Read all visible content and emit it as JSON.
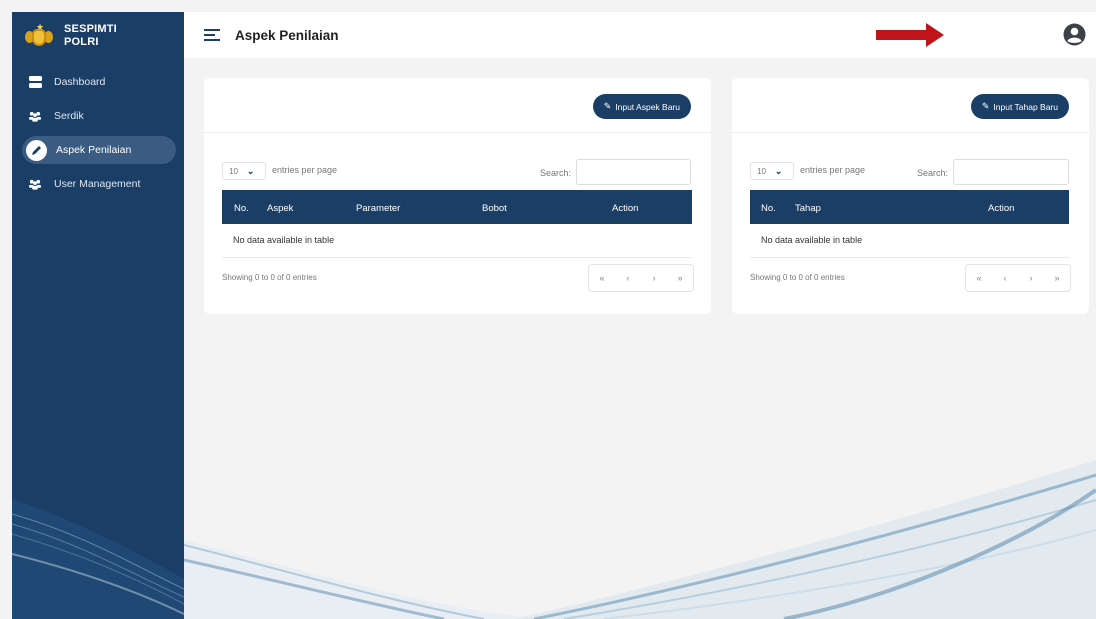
{
  "brand": {
    "line1": "SESPIMTI",
    "line2": "POLRI"
  },
  "sidebar": {
    "items": [
      {
        "label": "Dashboard",
        "icon": "server-icon",
        "active": false
      },
      {
        "label": "Serdik",
        "icon": "users-icon",
        "active": false
      },
      {
        "label": "Aspek Penilaian",
        "icon": "pen-icon",
        "active": true
      },
      {
        "label": "User Management",
        "icon": "users-icon",
        "active": false
      }
    ]
  },
  "header": {
    "title": "Aspek Penilaian"
  },
  "aspek_table": {
    "button_label": "Input Aspek Baru",
    "length_value": "10",
    "length_label": "entries per page",
    "search_label": "Search:",
    "search_value": "",
    "columns": [
      "No.",
      "Aspek",
      "Parameter",
      "Bobot",
      "Action"
    ],
    "empty_message": "No data available in table",
    "info": "Showing 0 to 0 of 0 entries",
    "pager": [
      "«",
      "‹",
      "›",
      "»"
    ]
  },
  "tahap_table": {
    "button_label": "Input Tahap Baru",
    "length_value": "10",
    "length_label": "entries per page",
    "search_label": "Search:",
    "search_value": "",
    "columns": [
      "No.",
      "Tahap",
      "Action"
    ],
    "empty_message": "No data available in table",
    "info": "Showing 0 to 0 of 0 entries",
    "pager": [
      "«",
      "‹",
      "›",
      "»"
    ]
  },
  "colors": {
    "primary": "#1a3e66",
    "active_nav": "#3a5b82",
    "arrow": "#c0141b",
    "background": "#f3f3f3"
  }
}
